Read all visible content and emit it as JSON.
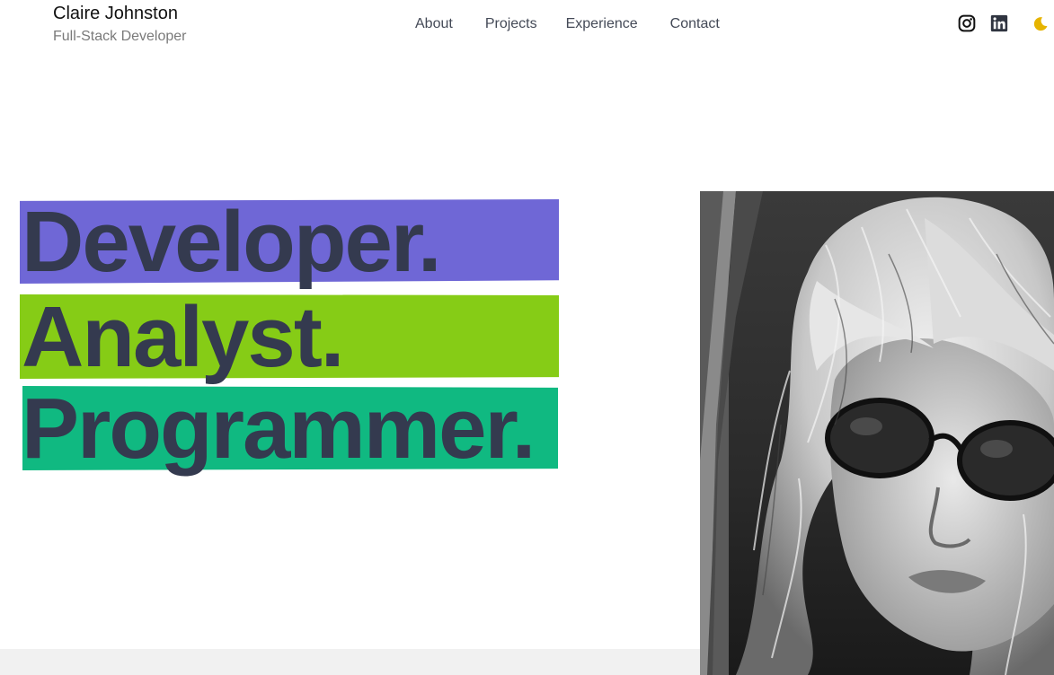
{
  "header": {
    "name": "Claire Johnston",
    "role": "Full-Stack Developer"
  },
  "nav": {
    "items": [
      {
        "label": "About"
      },
      {
        "label": "Projects"
      },
      {
        "label": "Experience"
      },
      {
        "label": "Contact"
      }
    ]
  },
  "social": {
    "icons": [
      "instagram-icon",
      "linkedin-icon",
      "moon-icon"
    ]
  },
  "hero": {
    "words": [
      {
        "text": "Developer.",
        "highlight": "#6f67d6"
      },
      {
        "text": "Analyst.",
        "highlight": "#86cc16"
      },
      {
        "text": "Programmer.",
        "highlight": "#10b981"
      }
    ]
  },
  "colors": {
    "text_dark": "#343a4f",
    "moon": "#e6b400",
    "band": "#f1f1f1"
  }
}
